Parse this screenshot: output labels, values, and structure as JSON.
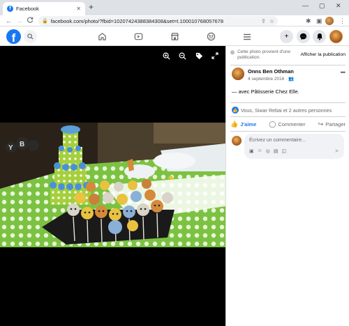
{
  "browser": {
    "tab_title": "Facebook",
    "tab_close": "✕",
    "new_tab": "+",
    "window_controls": [
      "—",
      "▢",
      "✕"
    ],
    "nav": [
      "←",
      "→",
      "C"
    ],
    "url": "facebook.com/photo/?fbid=10207424388384308&set=t.100010768057678"
  },
  "fb_nav": {
    "logo": "f",
    "icons": [
      "search-icon",
      "home-icon",
      "watch-icon",
      "marketplace-icon",
      "groups-icon",
      "menu-icon",
      "create-icon",
      "messenger-icon",
      "notifications-icon",
      "account-icon"
    ],
    "create_glyph": "+"
  },
  "viewer": {
    "tools": [
      "zoom-in-icon",
      "zoom-out-icon",
      "tag-icon",
      "fullscreen-icon"
    ]
  },
  "panel": {
    "shared_note": "Cette photo provient d'une publication.",
    "view_post": "Afficher la publication",
    "author_name": "Onns Ben Othman",
    "date": "4 septembre 2016 · ",
    "caption_prefix": "— avec ",
    "caption_tag": "Pâtisserie Chez Elle",
    "caption_suffix": ".",
    "reactions": "Vous, Siwar Rebai et 2 autres personnes",
    "like": "J'aime",
    "comment": "Commenter",
    "share": "Partager",
    "comment_placeholder": "Écrivez un commentaire..."
  },
  "colors": {
    "brand": "#1877f2",
    "viewer_bg": "#000000"
  }
}
